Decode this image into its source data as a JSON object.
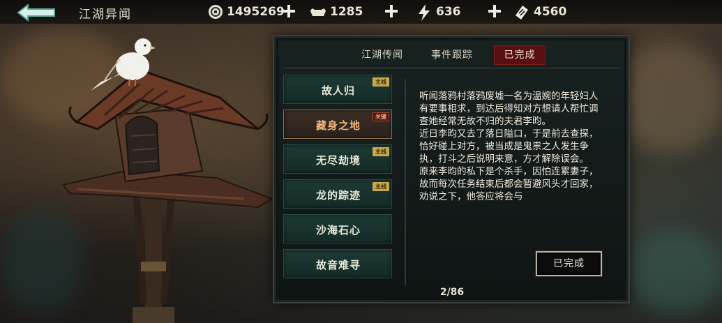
{
  "header": {
    "title": "江湖异闻",
    "resources": [
      {
        "icon": "coin-icon",
        "value": "1495269"
      },
      {
        "icon": "silver-ingot-icon",
        "value": "1285"
      },
      {
        "icon": "lightning-icon",
        "value": "636"
      },
      {
        "icon": "ticket-icon",
        "value": "4560"
      }
    ]
  },
  "tabs": [
    {
      "label": "江湖传闻",
      "active": false
    },
    {
      "label": "事件跟踪",
      "active": false
    },
    {
      "label": "已完成",
      "active": true
    }
  ],
  "events": [
    {
      "label": "故人归",
      "badge": "主线",
      "selected": false
    },
    {
      "label": "藏身之地",
      "badge": "关键",
      "selected": true
    },
    {
      "label": "无尽劫境",
      "badge": "主线",
      "selected": false
    },
    {
      "label": "龙的踪迹",
      "badge": "主线",
      "selected": false
    },
    {
      "label": "沙海石心",
      "badge": "",
      "selected": false
    },
    {
      "label": "故音难寻",
      "badge": "",
      "selected": false
    }
  ],
  "description": [
    "听闻落鸦村落鸦废墟一名为温婉的年轻妇人有要事相求，到达后得知对方想请人帮忙调查她经常无故不归的夫君李昀。",
    "近日李昀又去了落日隘口，于是前去查探，恰好碰上对方，被当成是鬼祟之人发生争执，打斗之后说明来意，方才解除误会。",
    "原来李昀的私下是个杀手，因怕连累妻子，故而每次任务结束后都会暂避风头才回家，劝说之下，他答应将会与"
  ],
  "complete_button": "已完成",
  "pager": "2/86",
  "colors": {
    "active_tab": "#5a0f10",
    "item_bg": "#1d3a35",
    "main_badge": "#c9a94a",
    "selected_text": "#f0b37b"
  }
}
